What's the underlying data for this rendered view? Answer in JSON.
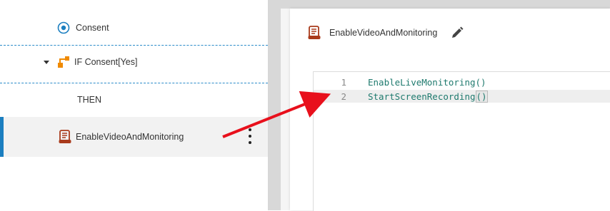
{
  "flow": {
    "items": [
      {
        "label": "Consent",
        "icon": "radio-icon"
      },
      {
        "label": "IF Consent[Yes]",
        "icon": "branch-icon"
      },
      {
        "label": "THEN"
      },
      {
        "label": "EnableVideoAndMonitoring",
        "icon": "script-icon"
      }
    ]
  },
  "editor": {
    "title": "EnableVideoAndMonitoring",
    "lines": [
      {
        "number": "1",
        "code": "EnableLiveMonitoring()"
      },
      {
        "number": "2",
        "code": "StartScreenRecording",
        "code_paren": "()"
      }
    ]
  },
  "colors": {
    "accent": "#1c7fc0",
    "branch_orange": "#f08a00",
    "script_red": "#a93b1c",
    "code_green": "#1f7a6e",
    "arrow_red": "#e8101c"
  }
}
